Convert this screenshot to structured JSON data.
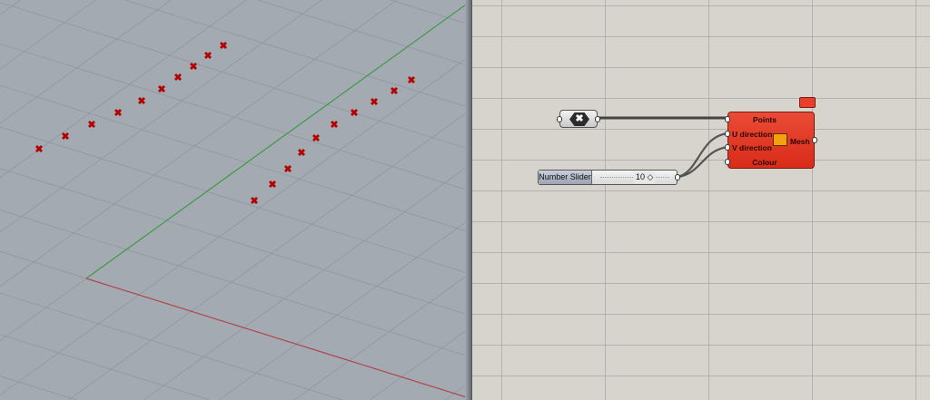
{
  "viewport": {
    "axis_x_color": "#b0464a",
    "axis_y_color": "#3f9a46",
    "point_color": "#b30000",
    "point_rows": 2,
    "points_per_row": 10
  },
  "canvas": {
    "point_param": {
      "icon": "point-param-icon",
      "glyph": "✖"
    },
    "slider": {
      "label": "Number Slider",
      "value": "10 ◇"
    },
    "component": {
      "inputs": [
        "Points",
        "U direction",
        "V direction",
        "Colour"
      ],
      "output": "Mesh",
      "icon": "mesh-icon",
      "color": "#e23a25"
    }
  }
}
